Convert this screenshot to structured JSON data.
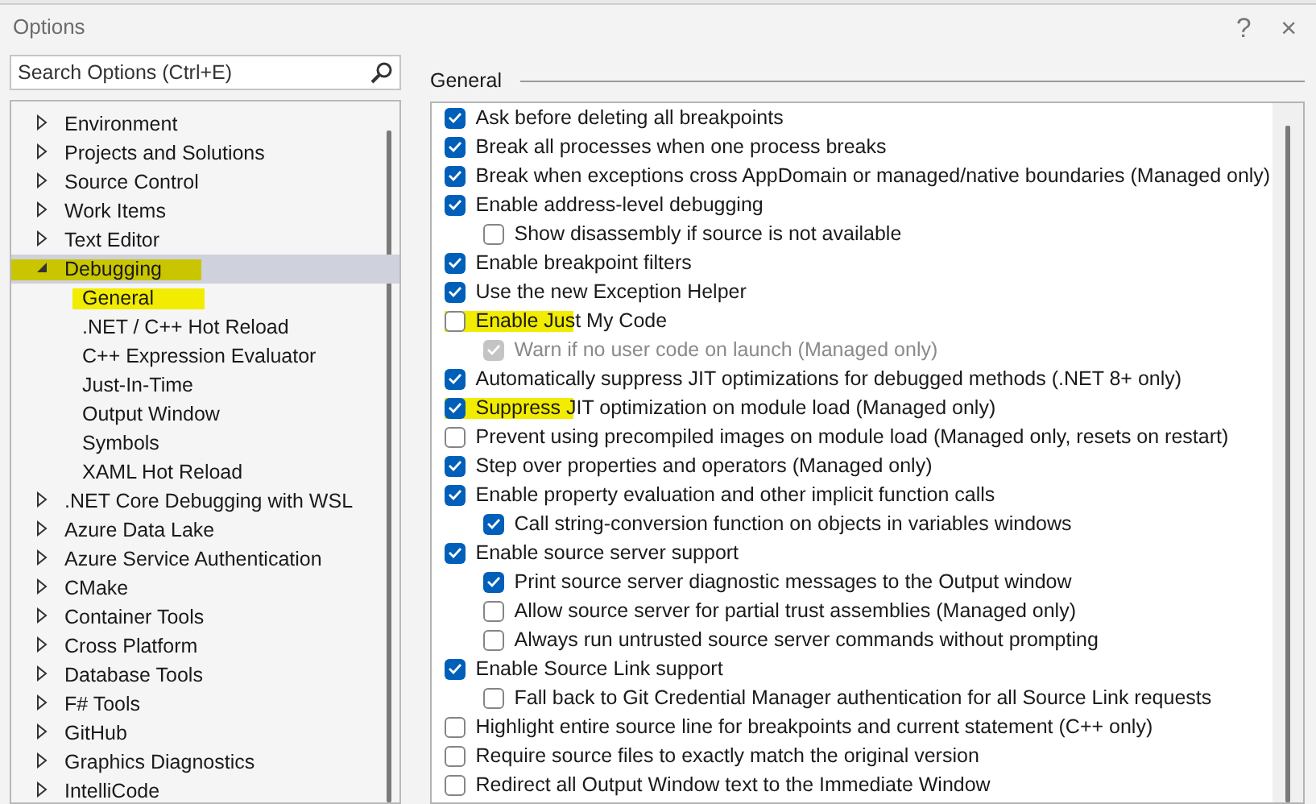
{
  "window": {
    "title": "Options",
    "help": "?",
    "close": "×"
  },
  "search": {
    "placeholder": "Search Options (Ctrl+E)"
  },
  "tree": [
    {
      "label": "Environment",
      "expanded": false,
      "selected": false,
      "highlighted": false
    },
    {
      "label": "Projects and Solutions",
      "expanded": false,
      "selected": false,
      "highlighted": false
    },
    {
      "label": "Source Control",
      "expanded": false,
      "selected": false,
      "highlighted": false
    },
    {
      "label": "Work Items",
      "expanded": false,
      "selected": false,
      "highlighted": false
    },
    {
      "label": "Text Editor",
      "expanded": false,
      "selected": false,
      "highlighted": false
    },
    {
      "label": "Debugging",
      "expanded": true,
      "selected": true,
      "highlighted": true,
      "children": [
        {
          "label": "General",
          "selected": false,
          "highlighted": true
        },
        {
          "label": ".NET / C++ Hot Reload",
          "selected": false,
          "highlighted": false
        },
        {
          "label": "C++ Expression Evaluator",
          "selected": false,
          "highlighted": false
        },
        {
          "label": "Just-In-Time",
          "selected": false,
          "highlighted": false
        },
        {
          "label": "Output Window",
          "selected": false,
          "highlighted": false
        },
        {
          "label": "Symbols",
          "selected": false,
          "highlighted": false
        },
        {
          "label": "XAML Hot Reload",
          "selected": false,
          "highlighted": false
        }
      ]
    },
    {
      "label": ".NET Core Debugging with WSL",
      "expanded": false,
      "selected": false,
      "highlighted": false
    },
    {
      "label": "Azure Data Lake",
      "expanded": false,
      "selected": false,
      "highlighted": false
    },
    {
      "label": "Azure Service Authentication",
      "expanded": false,
      "selected": false,
      "highlighted": false
    },
    {
      "label": "CMake",
      "expanded": false,
      "selected": false,
      "highlighted": false
    },
    {
      "label": "Container Tools",
      "expanded": false,
      "selected": false,
      "highlighted": false
    },
    {
      "label": "Cross Platform",
      "expanded": false,
      "selected": false,
      "highlighted": false
    },
    {
      "label": "Database Tools",
      "expanded": false,
      "selected": false,
      "highlighted": false
    },
    {
      "label": "F# Tools",
      "expanded": false,
      "selected": false,
      "highlighted": false
    },
    {
      "label": "GitHub",
      "expanded": false,
      "selected": false,
      "highlighted": false
    },
    {
      "label": "Graphics Diagnostics",
      "expanded": false,
      "selected": false,
      "highlighted": false
    },
    {
      "label": "IntelliCode",
      "expanded": false,
      "selected": false,
      "highlighted": false
    }
  ],
  "section_title": "General",
  "options": [
    {
      "label": "Ask before deleting all breakpoints",
      "checked": true,
      "disabled": false,
      "highlighted": false
    },
    {
      "label": "Break all processes when one process breaks",
      "checked": true,
      "disabled": false,
      "highlighted": false
    },
    {
      "label": "Break when exceptions cross AppDomain or managed/native boundaries (Managed only)",
      "checked": true,
      "disabled": false,
      "highlighted": false
    },
    {
      "label": "Enable address-level debugging",
      "checked": true,
      "disabled": false,
      "highlighted": false,
      "children": [
        {
          "label": "Show disassembly if source is not available",
          "checked": false,
          "disabled": false,
          "highlighted": false
        }
      ]
    },
    {
      "label": "Enable breakpoint filters",
      "checked": true,
      "disabled": false,
      "highlighted": false
    },
    {
      "label": "Use the new Exception Helper",
      "checked": true,
      "disabled": false,
      "highlighted": false
    },
    {
      "label": "Enable Just My Code",
      "checked": false,
      "disabled": false,
      "highlighted": true,
      "children": [
        {
          "label": "Warn if no user code on launch (Managed only)",
          "checked": true,
          "disabled": true,
          "highlighted": false
        }
      ]
    },
    {
      "label": "Automatically suppress JIT optimizations for debugged methods (.NET 8+ only)",
      "checked": true,
      "disabled": false,
      "highlighted": false
    },
    {
      "label": "Suppress JIT optimization on module load (Managed only)",
      "checked": true,
      "disabled": false,
      "highlighted": true
    },
    {
      "label": "Prevent using precompiled images on module load (Managed only, resets on restart)",
      "checked": false,
      "disabled": false,
      "highlighted": false
    },
    {
      "label": "Step over properties and operators (Managed only)",
      "checked": true,
      "disabled": false,
      "highlighted": false
    },
    {
      "label": "Enable property evaluation and other implicit function calls",
      "checked": true,
      "disabled": false,
      "highlighted": false,
      "children": [
        {
          "label": "Call string-conversion function on objects in variables windows",
          "checked": true,
          "disabled": false,
          "highlighted": false
        }
      ]
    },
    {
      "label": "Enable source server support",
      "checked": true,
      "disabled": false,
      "highlighted": false,
      "children": [
        {
          "label": "Print source server diagnostic messages to the Output window",
          "checked": true,
          "disabled": false,
          "highlighted": false
        },
        {
          "label": "Allow source server for partial trust assemblies (Managed only)",
          "checked": false,
          "disabled": false,
          "highlighted": false
        },
        {
          "label": "Always run untrusted source server commands without prompting",
          "checked": false,
          "disabled": false,
          "highlighted": false
        }
      ]
    },
    {
      "label": "Enable Source Link support",
      "checked": true,
      "disabled": false,
      "highlighted": false,
      "children": [
        {
          "label": "Fall back to Git Credential Manager authentication for all Source Link requests",
          "checked": false,
          "disabled": false,
          "highlighted": false
        }
      ]
    },
    {
      "label": "Highlight entire source line for breakpoints and current statement (C++ only)",
      "checked": false,
      "disabled": false,
      "highlighted": false
    },
    {
      "label": "Require source files to exactly match the original version",
      "checked": false,
      "disabled": false,
      "highlighted": false
    },
    {
      "label": "Redirect all Output Window text to the Immediate Window",
      "checked": false,
      "disabled": false,
      "highlighted": false
    }
  ]
}
